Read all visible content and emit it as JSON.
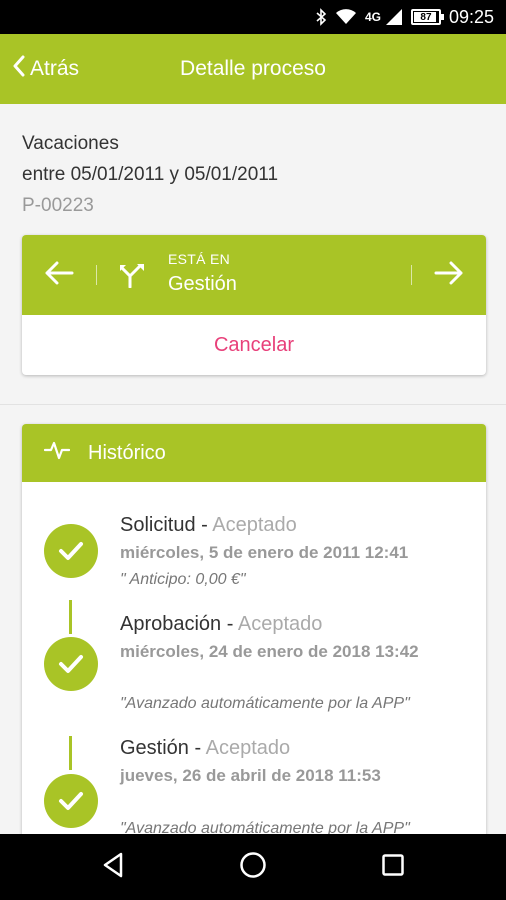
{
  "status_bar": {
    "network": "4G",
    "battery": "87",
    "time": "09:25"
  },
  "header": {
    "back_label": "Atrás",
    "title": "Detalle proceso"
  },
  "process": {
    "name": "Vacaciones",
    "range": "entre 05/01/2011 y 05/01/2011",
    "code": "P-00223"
  },
  "state": {
    "label": "ESTÁ EN",
    "value": "Gestión",
    "cancel_label": "Cancelar"
  },
  "history": {
    "title": "Histórico",
    "entries": [
      {
        "step": "Solicitud",
        "sep": " - ",
        "status": "Aceptado",
        "date": "miércoles, 5 de enero de 2011 12:41",
        "note": "\" Anticipo: 0,00 €\""
      },
      {
        "step": "Aprobación",
        "sep": " - ",
        "status": "Aceptado",
        "date": "miércoles, 24 de enero de 2018 13:42",
        "note": "\"Avanzado automáticamente por la APP\""
      },
      {
        "step": "Gestión",
        "sep": " - ",
        "status": "Aceptado",
        "date": "jueves, 26 de abril de 2018 11:53",
        "note": "\"Avanzado automáticamente por la APP\""
      }
    ]
  },
  "colors": {
    "brand": "#a9c426",
    "cancel": "#e8407a"
  }
}
